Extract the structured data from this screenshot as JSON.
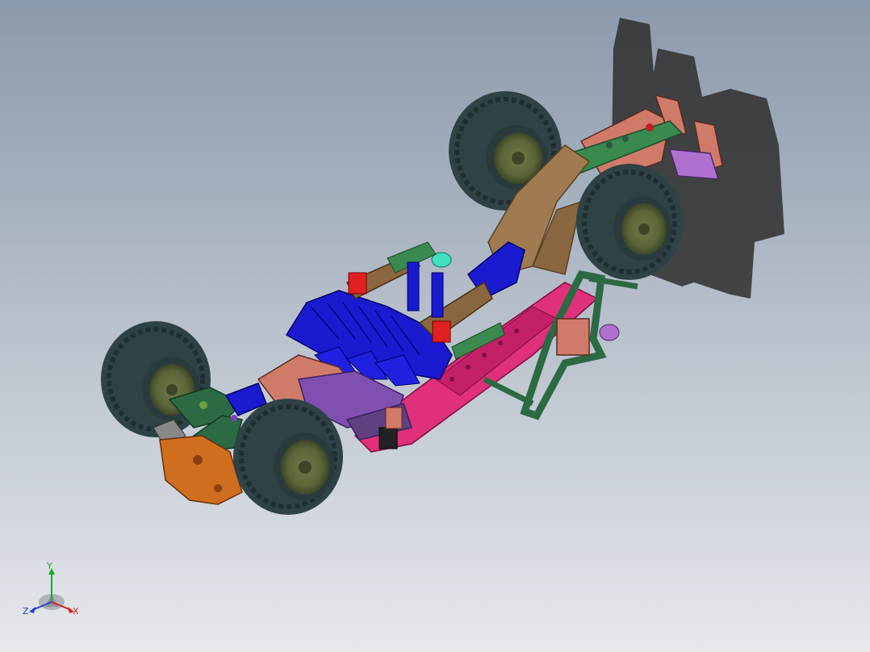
{
  "viewport": {
    "background_top": "#8a99ab",
    "background_bottom": "#e6e8ec"
  },
  "triad": {
    "x_label": "X",
    "y_label": "Y",
    "z_label": "Z",
    "x_color": "#d42020",
    "y_color": "#1fa82a",
    "z_color": "#2340c8"
  },
  "colors": {
    "tire": "#2f4347",
    "tire_tread": "#1f2e31",
    "rim": "#5e6a3a",
    "chassis_pink": "#e0307a",
    "blue_body": "#1a1ad0",
    "tan": "#a07a50",
    "green_frame": "#2c6a44",
    "orange": "#d06e20",
    "salmon": "#d07a6a",
    "purple": "#b070d0",
    "shadow": "#333333"
  }
}
